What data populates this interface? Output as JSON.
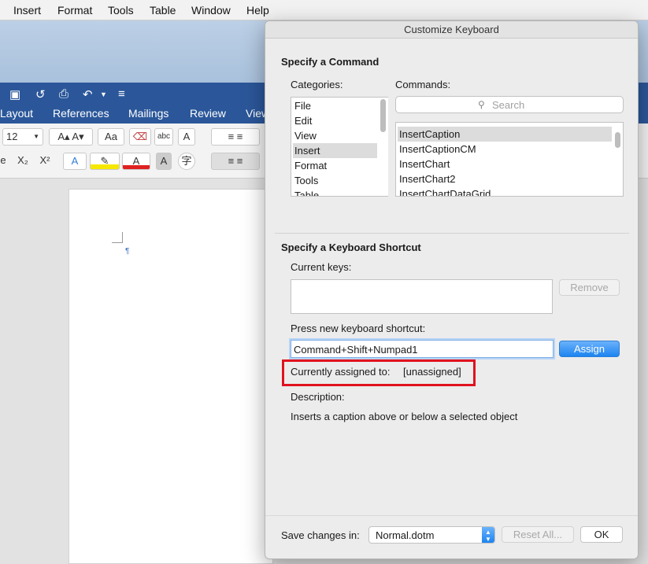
{
  "menubar": {
    "items": [
      "Insert",
      "Format",
      "Tools",
      "Table",
      "Window",
      "Help"
    ]
  },
  "word": {
    "ribbon_tabs": [
      "Layout",
      "References",
      "Mailings",
      "Review",
      "View"
    ],
    "font_size": "12",
    "paragraph_mark": "¶"
  },
  "dialog": {
    "title": "Customize Keyboard",
    "command_section_title": "Specify a Command",
    "categories_label": "Categories:",
    "commands_label": "Commands:",
    "categories": [
      "File",
      "Edit",
      "View",
      "Insert",
      "Format",
      "Tools",
      "Table"
    ],
    "selected_category": "Insert",
    "search_placeholder": "Search",
    "commands": [
      "InsertCaption",
      "InsertCaptionCM",
      "InsertChart",
      "InsertChart2",
      "InsertChartDataGrid"
    ],
    "selected_command": "InsertCaption",
    "shortcut_section_title": "Specify a Keyboard Shortcut",
    "current_keys_label": "Current keys:",
    "remove_label": "Remove",
    "new_shortcut_label": "Press new keyboard shortcut:",
    "new_shortcut_value": "Command+Shift+Numpad1",
    "assign_label": "Assign",
    "currently_assigned_label": "Currently assigned to:",
    "currently_assigned_value": "[unassigned]",
    "description_label": "Description:",
    "description_text": "Inserts a caption above or below a selected object",
    "save_changes_label": "Save changes in:",
    "save_changes_value": "Normal.dotm",
    "reset_all_label": "Reset All...",
    "ok_label": "OK"
  },
  "colors": {
    "word_blue": "#2b579a",
    "assign_blue": "#1d84f0",
    "highlight_red": "#e0121f"
  }
}
